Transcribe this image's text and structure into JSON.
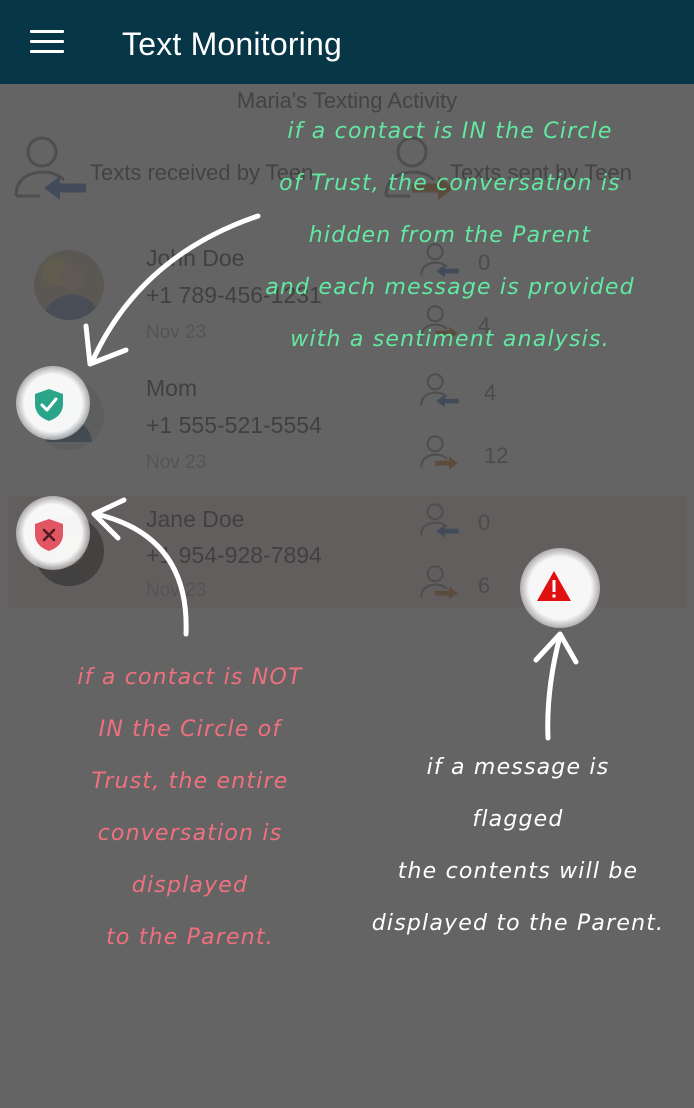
{
  "app_bar": {
    "title": "Text Monitoring",
    "menu_icon": "hamburger-menu-icon",
    "background": "#073646"
  },
  "activity": {
    "title": "Maria's Texting Activity",
    "received_label": "Texts received by Teen",
    "sent_label": "Texts sent by Teen",
    "received_icon": "person-incoming-arrow-icon",
    "sent_icon": "person-outgoing-arrow-icon"
  },
  "contacts": [
    {
      "name": "John Doe",
      "phone": "+1 789-456-1231",
      "date": "Nov 23",
      "received": "0",
      "sent": "4"
    },
    {
      "name": "Mom",
      "phone": "+1 555-521-5554",
      "date": "Nov 23",
      "received": "4",
      "sent": "12",
      "badge": "shield-check-icon"
    },
    {
      "name": "Jane Doe",
      "phone": "+1 954-928-7894",
      "date": "Nov 23",
      "received": "0",
      "sent": "6",
      "flagged": "1",
      "badge": "shield-x-icon",
      "flag_icon": "warning-triangle-icon",
      "highlight": "#f7dad6"
    }
  ],
  "annotations": {
    "circle_of_trust_in": [
      "if a contact is IN the Circle",
      "of Trust, the conversation is",
      "hidden from the Parent",
      "and each message is provided",
      "with a sentiment analysis."
    ],
    "circle_of_trust_not": [
      "if a contact is NOT",
      "IN the Circle of",
      "Trust, the entire",
      "conversation is",
      "displayed",
      "to the Parent."
    ],
    "flagged_message": [
      "if a message is",
      "flagged",
      "the contents will be",
      "displayed to the Parent."
    ]
  },
  "colors": {
    "in_circle_note": "#62e8a0",
    "not_in_circle_note": "#f0707e",
    "flagged_note": "#ffffff",
    "trusted_badge": "#2aa58a",
    "untrusted_badge": "#e25563",
    "warning": "#e01010",
    "received_arrow": "#2f66b3",
    "sent_arrow": "#c86a10"
  }
}
